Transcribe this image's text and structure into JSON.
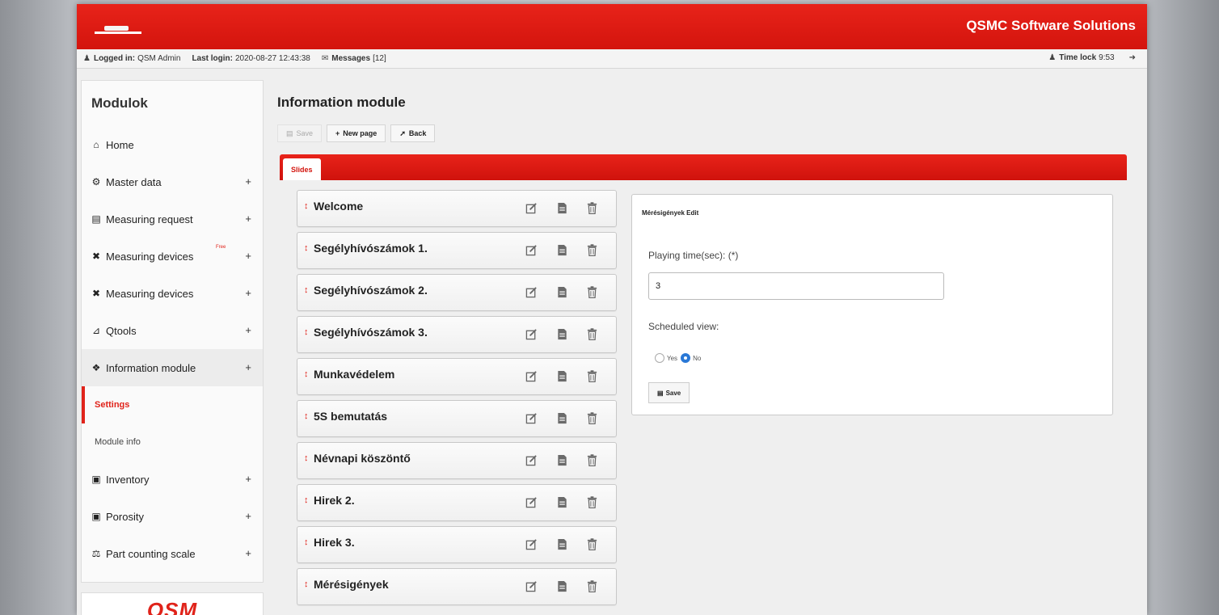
{
  "header": {
    "brand": "QSMC Software Solutions",
    "brand_color": "#e0231a"
  },
  "statusbar": {
    "logged_in_label": "Logged in:",
    "logged_in_value": "QSM Admin",
    "last_login_label": "Last login:",
    "last_login_value": "2020-08-27 12:43:38",
    "messages_label": "Messages",
    "messages_count": "[12]",
    "time_lock_label": "Time lock",
    "time_lock_value": "9:53"
  },
  "sidebar": {
    "title": "Modulok",
    "items": [
      {
        "label": "Home",
        "icon": "home-icon"
      },
      {
        "label": "Master data",
        "icon": "cogs-icon"
      },
      {
        "label": "Measuring request",
        "icon": "list-icon"
      },
      {
        "label": "Measuring devices",
        "icon": "tools-icon",
        "tag": "Free"
      },
      {
        "label": "Measuring devices",
        "icon": "tools-icon"
      },
      {
        "label": "Qtools",
        "icon": "chart-icon"
      },
      {
        "label": "Information module",
        "icon": "info-icon"
      },
      {
        "label": "Inventory",
        "icon": "bank-icon"
      },
      {
        "label": "Porosity",
        "icon": "image-icon"
      },
      {
        "label": "Part counting scale",
        "icon": "scale-icon"
      }
    ],
    "subitems": [
      {
        "label": "Settings"
      },
      {
        "label": "Module info"
      }
    ],
    "logo_text": "QSM"
  },
  "main": {
    "title": "Information module",
    "toolbar": {
      "save": "Save",
      "new_page": "New page",
      "back": "Back"
    },
    "tab": "Slides",
    "slides": [
      "Welcome",
      "Segélyhívószámok 1.",
      "Segélyhívószámok 2.",
      "Segélyhívószámok 3.",
      "Munkavédelem",
      "5S bemutatás",
      "Névnapi köszöntő",
      "Hirek 2.",
      "Hirek 3.",
      "Mérésigények"
    ],
    "edit_panel": {
      "title": "Mérésigények Edit",
      "playing_time_label": "Playing time(sec): (*)",
      "playing_time_value": "3",
      "scheduled_view_label": "Scheduled view:",
      "yes_label": "Yes",
      "no_label": "No",
      "scheduled_view_selected": "No",
      "save_label": "Save"
    }
  }
}
